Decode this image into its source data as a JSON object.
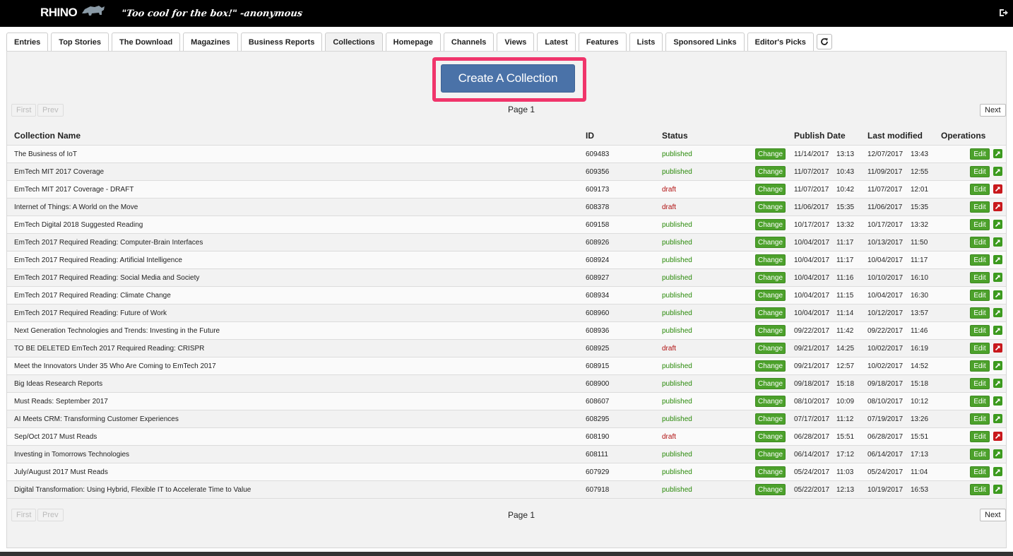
{
  "header": {
    "logo_text": "RHINO",
    "tagline": "\"Too cool for the box!\" -anonymous"
  },
  "tabs": [
    {
      "label": "Entries"
    },
    {
      "label": "Top Stories"
    },
    {
      "label": "The Download"
    },
    {
      "label": "Magazines"
    },
    {
      "label": "Business Reports"
    },
    {
      "label": "Collections",
      "active": true
    },
    {
      "label": "Homepage"
    },
    {
      "label": "Channels"
    },
    {
      "label": "Views"
    },
    {
      "label": "Latest"
    },
    {
      "label": "Features"
    },
    {
      "label": "Lists"
    },
    {
      "label": "Sponsored Links"
    },
    {
      "label": "Editor's Picks"
    }
  ],
  "icons": {
    "refresh": "refresh-icon",
    "logout": "logout-icon",
    "external_link": "external-link-icon"
  },
  "colors": {
    "highlight": "#f0356b",
    "primary_button": "#4a72a8",
    "success": "#4ca12b",
    "published": "#2a8a0a",
    "draft": "#b01010",
    "danger": "#c8181c"
  },
  "create_button": "Create A Collection",
  "pagination": {
    "first": "First",
    "prev": "Prev",
    "next": "Next",
    "page_label": "Page 1"
  },
  "table": {
    "headers": {
      "name": "Collection Name",
      "id": "ID",
      "status": "Status",
      "publish_date": "Publish Date",
      "last_modified": "Last modified",
      "operations": "Operations"
    },
    "change_label": "Change",
    "edit_label": "Edit",
    "rows": [
      {
        "name": "The Business of IoT",
        "id": "609483",
        "status": "published",
        "pub_date": "11/14/2017",
        "pub_time": "13:13",
        "mod_date": "12/07/2017",
        "mod_time": "13:43"
      },
      {
        "name": "EmTech MIT 2017 Coverage",
        "id": "609356",
        "status": "published",
        "pub_date": "11/07/2017",
        "pub_time": "10:43",
        "mod_date": "11/09/2017",
        "mod_time": "12:55"
      },
      {
        "name": "EmTech MIT 2017 Coverage - DRAFT",
        "id": "609173",
        "status": "draft",
        "pub_date": "11/07/2017",
        "pub_time": "10:42",
        "mod_date": "11/07/2017",
        "mod_time": "12:01"
      },
      {
        "name": "Internet of Things: A World on the Move",
        "id": "608378",
        "status": "draft",
        "pub_date": "11/06/2017",
        "pub_time": "15:35",
        "mod_date": "11/06/2017",
        "mod_time": "15:35"
      },
      {
        "name": "EmTech Digital 2018 Suggested Reading",
        "id": "609158",
        "status": "published",
        "pub_date": "10/17/2017",
        "pub_time": "13:32",
        "mod_date": "10/17/2017",
        "mod_time": "13:32"
      },
      {
        "name": "EmTech 2017 Required Reading: Computer-Brain Interfaces",
        "id": "608926",
        "status": "published",
        "pub_date": "10/04/2017",
        "pub_time": "11:17",
        "mod_date": "10/13/2017",
        "mod_time": "11:50"
      },
      {
        "name": "EmTech 2017 Required Reading: Artificial Intelligence",
        "id": "608924",
        "status": "published",
        "pub_date": "10/04/2017",
        "pub_time": "11:17",
        "mod_date": "10/04/2017",
        "mod_time": "11:17"
      },
      {
        "name": "EmTech 2017 Required Reading: Social Media and Society",
        "id": "608927",
        "status": "published",
        "pub_date": "10/04/2017",
        "pub_time": "11:16",
        "mod_date": "10/10/2017",
        "mod_time": "16:10"
      },
      {
        "name": "EmTech 2017 Required Reading: Climate Change",
        "id": "608934",
        "status": "published",
        "pub_date": "10/04/2017",
        "pub_time": "11:15",
        "mod_date": "10/04/2017",
        "mod_time": "16:30"
      },
      {
        "name": "EmTech 2017 Required Reading: Future of Work",
        "id": "608960",
        "status": "published",
        "pub_date": "10/04/2017",
        "pub_time": "11:14",
        "mod_date": "10/12/2017",
        "mod_time": "13:57"
      },
      {
        "name": "Next Generation Technologies and Trends: Investing in the Future",
        "id": "608936",
        "status": "published",
        "pub_date": "09/22/2017",
        "pub_time": "11:42",
        "mod_date": "09/22/2017",
        "mod_time": "11:46"
      },
      {
        "name": "TO BE DELETED EmTech 2017 Required Reading: CRISPR",
        "id": "608925",
        "status": "draft",
        "pub_date": "09/21/2017",
        "pub_time": "14:25",
        "mod_date": "10/02/2017",
        "mod_time": "16:19"
      },
      {
        "name": "Meet the Innovators Under 35 Who Are Coming to EmTech 2017",
        "id": "608915",
        "status": "published",
        "pub_date": "09/21/2017",
        "pub_time": "12:57",
        "mod_date": "10/02/2017",
        "mod_time": "14:52"
      },
      {
        "name": "Big Ideas Research Reports",
        "id": "608900",
        "status": "published",
        "pub_date": "09/18/2017",
        "pub_time": "15:18",
        "mod_date": "09/18/2017",
        "mod_time": "15:18"
      },
      {
        "name": "Must Reads: September 2017",
        "id": "608607",
        "status": "published",
        "pub_date": "08/10/2017",
        "pub_time": "10:09",
        "mod_date": "08/10/2017",
        "mod_time": "10:12"
      },
      {
        "name": "AI Meets CRM: Transforming Customer Experiences",
        "id": "608295",
        "status": "published",
        "pub_date": "07/17/2017",
        "pub_time": "11:12",
        "mod_date": "07/19/2017",
        "mod_time": "13:26"
      },
      {
        "name": "Sep/Oct 2017 Must Reads",
        "id": "608190",
        "status": "draft",
        "pub_date": "06/28/2017",
        "pub_time": "15:51",
        "mod_date": "06/28/2017",
        "mod_time": "15:51"
      },
      {
        "name": "Investing in Tomorrows Technologies",
        "id": "608111",
        "status": "published",
        "pub_date": "06/14/2017",
        "pub_time": "17:12",
        "mod_date": "06/14/2017",
        "mod_time": "17:13"
      },
      {
        "name": "July/August 2017 Must Reads",
        "id": "607929",
        "status": "published",
        "pub_date": "05/24/2017",
        "pub_time": "11:03",
        "mod_date": "05/24/2017",
        "mod_time": "11:04"
      },
      {
        "name": "Digital Transformation: Using Hybrid, Flexible IT to Accelerate Time to Value",
        "id": "607918",
        "status": "published",
        "pub_date": "05/22/2017",
        "pub_time": "12:13",
        "mod_date": "10/19/2017",
        "mod_time": "16:53"
      }
    ]
  }
}
